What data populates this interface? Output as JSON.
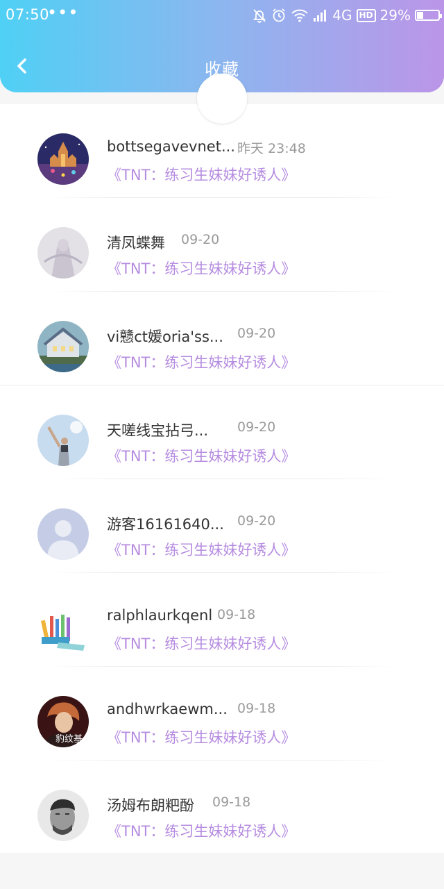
{
  "status_bar": {
    "time": "07:50",
    "dots": "•••",
    "network": "4G",
    "hd": "HD",
    "battery_text": "29%",
    "battery_level": 0.29
  },
  "header": {
    "title": "收藏",
    "back_icon": "chevron-left-icon"
  },
  "favorites": [
    {
      "name": "bottsegavevnet...",
      "time": "昨天 23:48",
      "book": "《TNT：练习生妹妹好诱人》"
    },
    {
      "name": "清凤蝶舞",
      "time": "09-20",
      "book": "《TNT：练习生妹妹好诱人》"
    },
    {
      "name": "vi戆ct媛oria'ss...",
      "time": "09-20",
      "book": "《TNT：练习生妹妹好诱人》"
    },
    {
      "name": "天嗟线宝拈弓...",
      "time": "09-20",
      "book": "《TNT：练习生妹妹好诱人》"
    },
    {
      "name": "游客16161640...",
      "time": "09-20",
      "book": "《TNT：练习生妹妹好诱人》"
    },
    {
      "name": "ralphlaurkqenl",
      "time": "09-18",
      "book": "《TNT：练习生妹妹好诱人》"
    },
    {
      "name": "andhwrkaewm...",
      "time": "09-18",
      "book": "《TNT：练习生妹妹好诱人》"
    },
    {
      "name": "汤姆布朗粑酚",
      "time": "09-18",
      "book": "《TNT：练习生妹妹好诱人》"
    }
  ],
  "avatar_labels": {
    "seventh": "豹纹基"
  },
  "colors": {
    "header_gradient_start": "#4fd0f5",
    "header_gradient_end": "#bb95e8",
    "book_title": "#b68ce0",
    "timestamp": "#9a9a9a"
  }
}
